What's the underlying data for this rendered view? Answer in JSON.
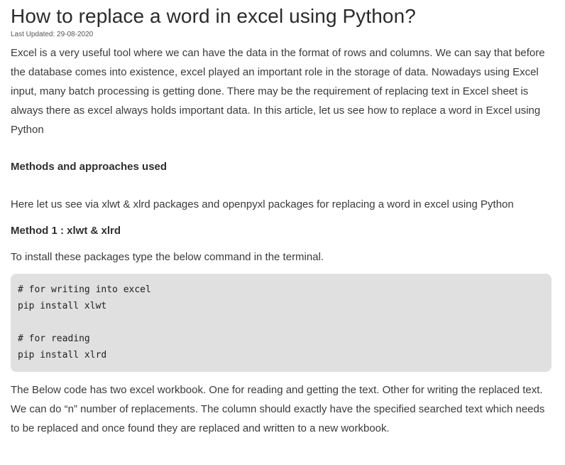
{
  "article": {
    "title": "How to replace a word in excel using Python?",
    "last_updated": "Last Updated: 29-08-2020",
    "intro": "Excel is a very useful tool where we can have the data in the format of rows and columns. We can say that before the database comes into existence, excel played an important role in the storage of data. Nowadays using Excel input, many batch processing is getting done. There may be the requirement of replacing text in Excel sheet is always there as excel always holds important data. In this article, let us see how to replace a word in Excel using Python",
    "methods_heading": "Methods and approaches used",
    "approach_text": "Here let us see via xlwt & xlrd packages and openpyxl packages for replacing a word in excel using Python",
    "method1_heading": "Method 1 : xlwt & xlrd",
    "install_note": "To install these packages type the below command in the terminal.",
    "code_lines": [
      "# for writing into excel",
      "pip install xlwt",
      "",
      "# for reading",
      "pip install xlrd"
    ],
    "outro": "The Below code has two excel workbook. One for reading and getting the text. Other for writing the replaced text. We can do “n” number of replacements. The column should exactly have the specified searched text which needs to be replaced and once found they are replaced and written to a new workbook."
  },
  "colors": {
    "code_background": "#e0e0e0",
    "text": "#3a3a3a"
  }
}
